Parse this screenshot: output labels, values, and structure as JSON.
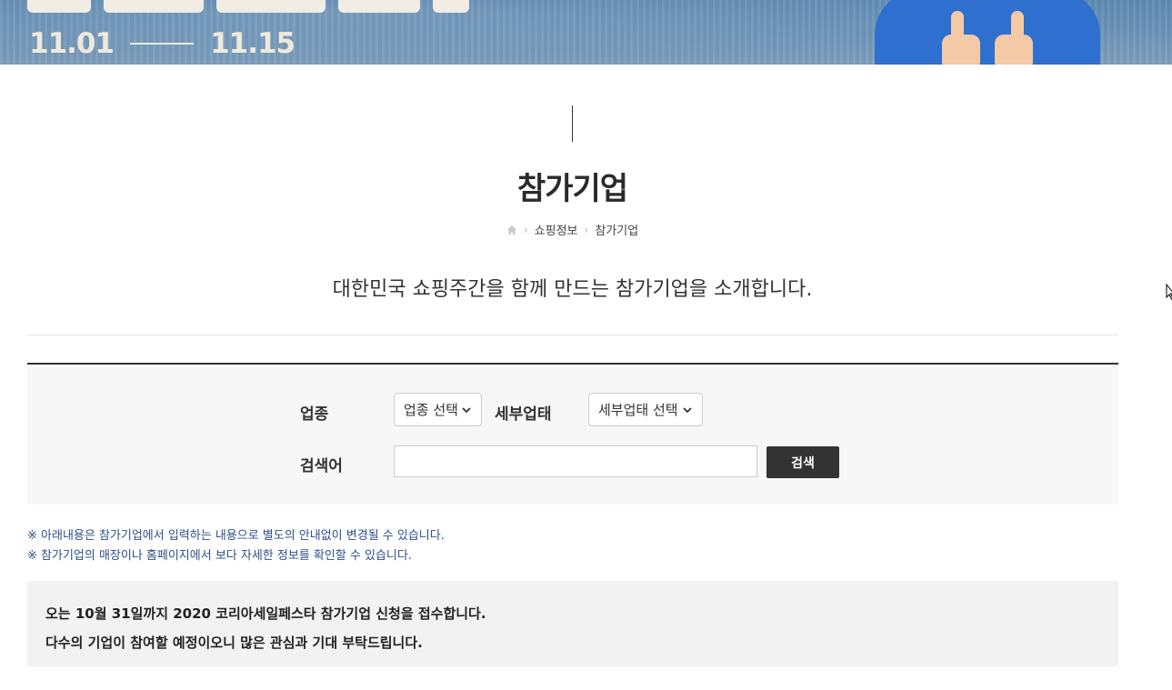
{
  "banner": {
    "date_start": "11.01",
    "date_end": "11.15"
  },
  "page": {
    "title": "참가기업",
    "intro": "대한민국 쇼핑주간을 함께 만드는 참가기업을 소개합니다."
  },
  "breadcrumb": {
    "home_icon": "home-icon",
    "items": [
      "쇼핑정보",
      "참가기업"
    ]
  },
  "search": {
    "industry_label": "업종",
    "industry_selected": "업종 선택",
    "sub_industry_label": "세부업태",
    "sub_industry_selected": "세부업태 선택",
    "keyword_label": "검색어",
    "keyword_value": "",
    "search_button": "검색"
  },
  "notices": [
    "※ 아래내용은 참가기업에서 입력하는 내용으로 별도의 안내없이 변경될 수 있습니다.",
    "※ 참가기업의 매장이나 홈페이지에서 보다 자세한 정보를 확인할 수 있습니다."
  ],
  "announcement": {
    "line1": "오는 10월 31일까지 2020 코리아세일페스타 참가기업 신청을 접수합니다.",
    "line2": "다수의 기업이 참여할 예정이오니 많은 관심과 기대 부탁드립니다."
  },
  "colors": {
    "banner_bg": "#6b93b8",
    "button_bg": "#333333",
    "notice_text": "#2d4f8a",
    "panel_bg": "#f7f7f7"
  }
}
